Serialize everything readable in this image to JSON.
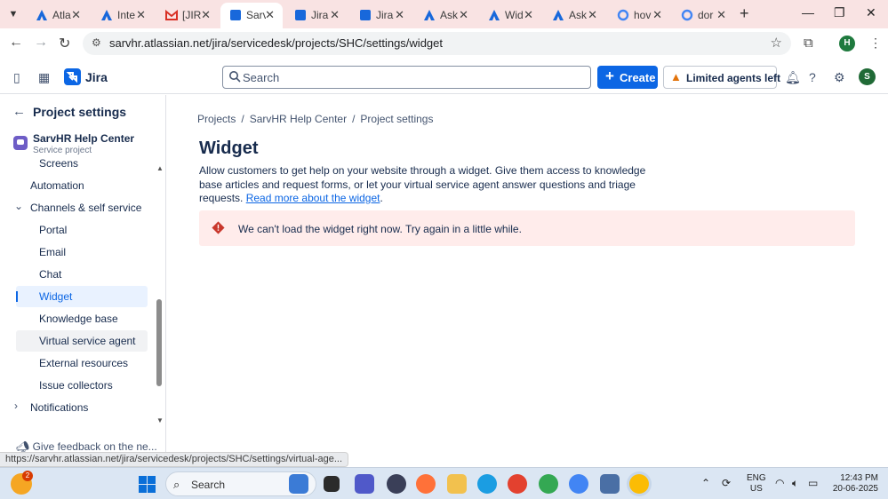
{
  "browser": {
    "tabs": [
      {
        "label": "Atla",
        "icon": "atlassian-icon",
        "active": false
      },
      {
        "label": "Inte",
        "icon": "atlassian-icon",
        "active": false
      },
      {
        "label": "[JIR",
        "icon": "gmail-icon",
        "active": false
      },
      {
        "label": "Sarv",
        "icon": "jira-icon",
        "active": true
      },
      {
        "label": "Jira",
        "icon": "jira-icon",
        "active": false
      },
      {
        "label": "Jira",
        "icon": "jira-icon",
        "active": false
      },
      {
        "label": "Ask",
        "icon": "atlassian-icon",
        "active": false
      },
      {
        "label": "Wid",
        "icon": "atlassian-icon",
        "active": false
      },
      {
        "label": "Ask",
        "icon": "atlassian-icon",
        "active": false
      },
      {
        "label": "hov",
        "icon": "google-icon",
        "active": false
      },
      {
        "label": "dor",
        "icon": "google-icon",
        "active": false
      }
    ],
    "url": "sarvhr.atlassian.net/jira/servicedesk/projects/SHC/settings/widget",
    "profile_initial": "H"
  },
  "jira_nav": {
    "product_name": "Jira",
    "search_placeholder": "Search",
    "create_label": "Create",
    "limited_label": "Limited agents left",
    "avatar_initial": "S"
  },
  "sidebar": {
    "back_label": "Project settings",
    "project_name": "SarvHR Help Center",
    "project_type": "Service project",
    "items": [
      {
        "label": "Screens",
        "indent": 2,
        "state": "normal"
      },
      {
        "label": "Automation",
        "indent": 1,
        "state": "normal"
      },
      {
        "label": "Channels & self service",
        "indent": 1,
        "state": "expanded"
      },
      {
        "label": "Portal",
        "indent": 2,
        "state": "normal"
      },
      {
        "label": "Email",
        "indent": 2,
        "state": "normal"
      },
      {
        "label": "Chat",
        "indent": 2,
        "state": "normal"
      },
      {
        "label": "Widget",
        "indent": 2,
        "state": "active"
      },
      {
        "label": "Knowledge base",
        "indent": 2,
        "state": "normal"
      },
      {
        "label": "Virtual service agent",
        "indent": 2,
        "state": "hover"
      },
      {
        "label": "External resources",
        "indent": 2,
        "state": "normal"
      },
      {
        "label": "Issue collectors",
        "indent": 2,
        "state": "normal"
      },
      {
        "label": "Notifications",
        "indent": 1,
        "state": "collapsed"
      }
    ],
    "feedback_label": "Give feedback on the ne..."
  },
  "main": {
    "breadcrumb": [
      "Projects",
      "SarvHR Help Center",
      "Project settings"
    ],
    "title": "Widget",
    "description": "Allow customers to get help on your website through a widget. Give them access to knowledge base articles and request forms, or let your virtual service agent answer questions and triage requests.",
    "read_more_label": "Read more about the widget",
    "error_message": "We can't load the widget right now. Try again in a little while."
  },
  "status_link": "https://sarvhr.atlassian.net/jira/servicedesk/projects/SHC/settings/virtual-age...",
  "taskbar": {
    "weather_badge": "2",
    "search_label": "Search",
    "lang_line1": "ENG",
    "lang_line2": "US",
    "time": "12:43 PM",
    "date": "20-06-2025"
  },
  "colors": {
    "brand": "#0c66e4",
    "error_bg": "#ffeceb",
    "error_icon": "#c9372c",
    "warning": "#e2730b",
    "tabstrip": "#f9e3e3"
  }
}
